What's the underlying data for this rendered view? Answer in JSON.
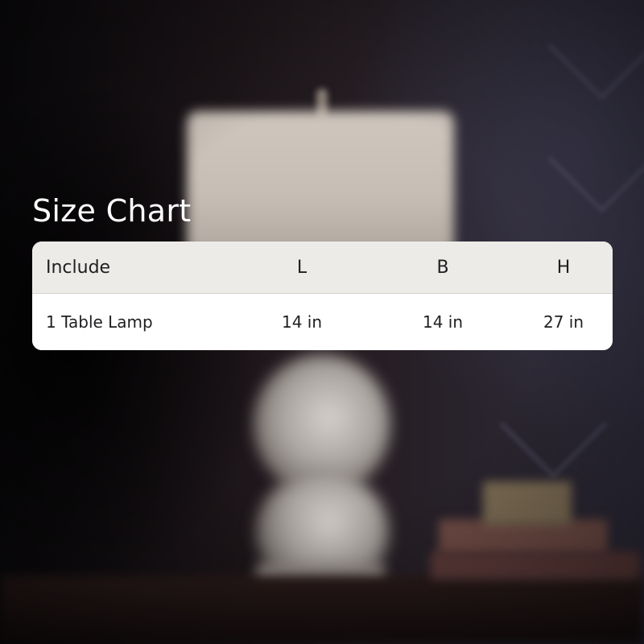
{
  "title": "Size Chart",
  "table": {
    "headers": [
      "Include",
      "L",
      "B",
      "H"
    ],
    "rows": [
      [
        "1 Table Lamp",
        "14 in",
        "14 in",
        "27 in"
      ]
    ]
  },
  "colors": {
    "header_bg": "#ecebe7",
    "row_bg": "#ffffff",
    "title_text": "#ffffff",
    "cell_text": "#1f1f22"
  }
}
